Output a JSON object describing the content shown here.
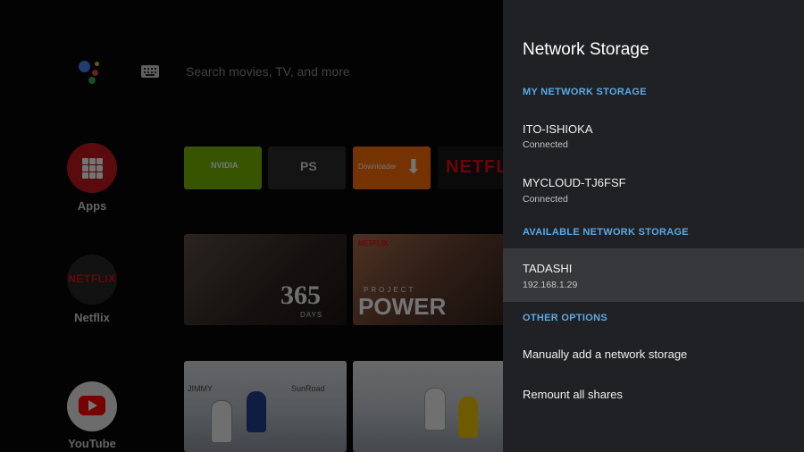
{
  "home": {
    "search_placeholder": "Search movies, TV, and more",
    "side_items": [
      {
        "label": "Apps",
        "icon": "apps-grid-icon"
      },
      {
        "label": "Netflix",
        "icon": "netflix-logo"
      },
      {
        "label": "YouTube",
        "icon": "youtube-play-icon"
      }
    ],
    "netflix_tile_text": "NETFLIX",
    "app_cards": [
      {
        "name": "nvidia",
        "text": "NVIDIA"
      },
      {
        "name": "playstation",
        "text": "PS"
      },
      {
        "name": "downloader",
        "text": "Downloader"
      },
      {
        "name": "netflix",
        "text": "NETFLIX"
      }
    ],
    "posters": {
      "p365_big": "365",
      "p365_small": "DAYS",
      "power_line1": "PROJECT",
      "power_line2": "POWER",
      "power_badge": "NETFLIX"
    },
    "hockey_ads": [
      "JIMMY",
      "SunRoad"
    ]
  },
  "panel": {
    "title": "Network Storage",
    "sections": {
      "my": "MY NETWORK STORAGE",
      "available": "AVAILABLE NETWORK STORAGE",
      "other": "OTHER OPTIONS"
    },
    "my_storage": [
      {
        "name": "ITO-ISHIOKA",
        "status": "Connected"
      },
      {
        "name": "MYCLOUD-TJ6FSF",
        "status": "Connected"
      }
    ],
    "available_storage": [
      {
        "name": "TADASHI",
        "address": "192.168.1.29"
      }
    ],
    "options": [
      {
        "label": "Manually add a network storage"
      },
      {
        "label": "Remount all shares"
      }
    ],
    "focused_item": "TADASHI"
  },
  "colors": {
    "panel_bg": "#202124",
    "focus_bg": "#37383b",
    "section_accent": "#5aa9e6"
  }
}
